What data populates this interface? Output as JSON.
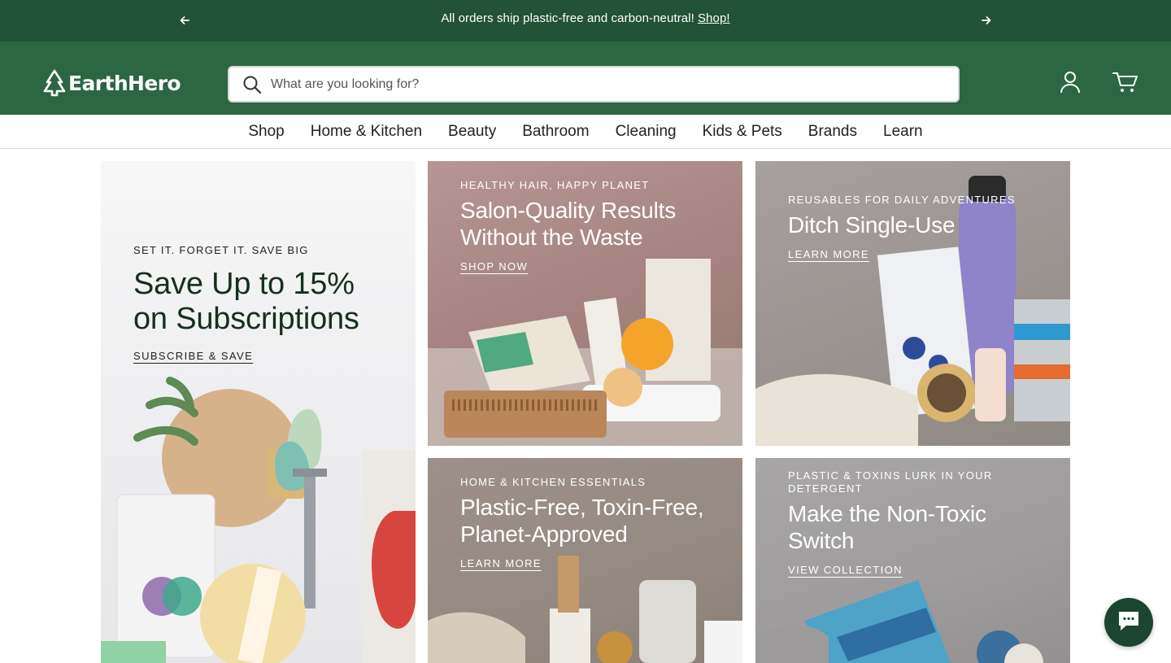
{
  "announcement": {
    "message": "All orders ship plastic-free and carbon-neutral!",
    "link_label": "Shop!"
  },
  "header": {
    "logo_text": "EarthHero",
    "search_placeholder": "What are you looking for?"
  },
  "nav": {
    "items": [
      "Shop",
      "Home & Kitchen",
      "Beauty",
      "Bathroom",
      "Cleaning",
      "Kids & Pets",
      "Brands",
      "Learn"
    ]
  },
  "promos": {
    "subscriptions": {
      "eyebrow": "SET IT. FORGET IT. SAVE BIG",
      "headline": "Save Up to 15% on Subscriptions",
      "cta": "SUBSCRIBE & SAVE"
    },
    "hair": {
      "eyebrow": "HEALTHY HAIR, HAPPY PLANET",
      "headline": "Salon-Quality Results Without the Waste",
      "cta": "SHOP NOW"
    },
    "reusables": {
      "eyebrow": "REUSABLES FOR DAILY ADVENTURES",
      "headline": "Ditch Single-Use",
      "cta": "LEARN MORE"
    },
    "kitchen": {
      "eyebrow": "HOME & KITCHEN ESSENTIALS",
      "headline": "Plastic-Free, Toxin-Free, Planet-Approved",
      "cta": "LEARN MORE"
    },
    "detergent": {
      "eyebrow": "PLASTIC & TOXINS LURK IN YOUR DETERGENT",
      "headline": "Make the Non-Toxic Switch",
      "cta": "VIEW COLLECTION"
    }
  },
  "colors": {
    "announcement_bg": "#225238",
    "header_bg": "#2c6642",
    "chat_bg": "#1c4530"
  },
  "icons": [
    "arrow-left-icon",
    "arrow-right-icon",
    "search-icon",
    "account-icon",
    "cart-icon",
    "chat-icon",
    "logo-tree-icon"
  ]
}
